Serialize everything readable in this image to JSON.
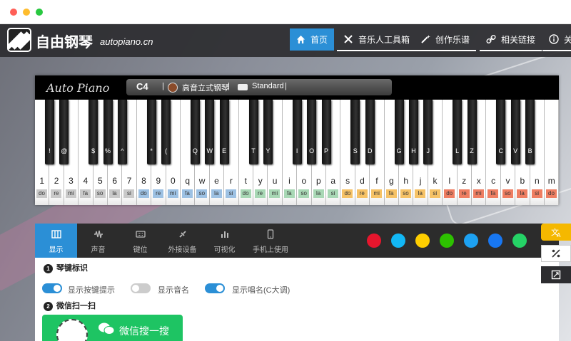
{
  "site": {
    "name": "自由钢琴",
    "domain": "autopiano.cn"
  },
  "nav": [
    {
      "label": "首页",
      "icon": "home-icon"
    },
    {
      "label": "音乐人工具箱",
      "icon": "tools-icon"
    },
    {
      "label": "创作乐谱",
      "icon": "magic-wand-icon"
    },
    {
      "label": "相关链接",
      "icon": "link-icon"
    },
    {
      "label": "关",
      "icon": "info-icon"
    }
  ],
  "piano_bar": {
    "script_logo": "Auto Piano",
    "note": "C4",
    "instrument": "高音立式钢琴",
    "mode": "Standard",
    "sep": "|"
  },
  "white_keys": [
    {
      "key": "1",
      "sol": "do",
      "color": "#c9c9c9"
    },
    {
      "key": "2",
      "sol": "re",
      "color": "#c9c9c9"
    },
    {
      "key": "3",
      "sol": "mi",
      "color": "#c9c9c9"
    },
    {
      "key": "4",
      "sol": "fa",
      "color": "#c9c9c9"
    },
    {
      "key": "5",
      "sol": "so",
      "color": "#c9c9c9"
    },
    {
      "key": "6",
      "sol": "la",
      "color": "#c9c9c9"
    },
    {
      "key": "7",
      "sol": "si",
      "color": "#c9c9c9"
    },
    {
      "key": "8",
      "sol": "do",
      "color": "#9dc1e3"
    },
    {
      "key": "9",
      "sol": "re",
      "color": "#9dc1e3"
    },
    {
      "key": "0",
      "sol": "mi",
      "color": "#9dc1e3"
    },
    {
      "key": "q",
      "sol": "fa",
      "color": "#9dc1e3"
    },
    {
      "key": "w",
      "sol": "so",
      "color": "#9dc1e3"
    },
    {
      "key": "e",
      "sol": "la",
      "color": "#9dc1e3"
    },
    {
      "key": "r",
      "sol": "si",
      "color": "#9dc1e3"
    },
    {
      "key": "t",
      "sol": "do",
      "color": "#a8d8b5"
    },
    {
      "key": "y",
      "sol": "re",
      "color": "#a8d8b5"
    },
    {
      "key": "u",
      "sol": "mi",
      "color": "#a8d8b5"
    },
    {
      "key": "i",
      "sol": "fa",
      "color": "#a8d8b5"
    },
    {
      "key": "o",
      "sol": "so",
      "color": "#a8d8b5"
    },
    {
      "key": "p",
      "sol": "la",
      "color": "#a8d8b5"
    },
    {
      "key": "a",
      "sol": "si",
      "color": "#a8d8b5"
    },
    {
      "key": "s",
      "sol": "do",
      "color": "#f6c266"
    },
    {
      "key": "d",
      "sol": "re",
      "color": "#f6c266"
    },
    {
      "key": "f",
      "sol": "mi",
      "color": "#f6c266"
    },
    {
      "key": "g",
      "sol": "fa",
      "color": "#f6c266"
    },
    {
      "key": "h",
      "sol": "so",
      "color": "#f6c266"
    },
    {
      "key": "j",
      "sol": "la",
      "color": "#f6c266"
    },
    {
      "key": "k",
      "sol": "si",
      "color": "#f6c266"
    },
    {
      "key": "l",
      "sol": "do",
      "color": "#ef7e62"
    },
    {
      "key": "z",
      "sol": "re",
      "color": "#ef7e62"
    },
    {
      "key": "x",
      "sol": "mi",
      "color": "#ef7e62"
    },
    {
      "key": "c",
      "sol": "fa",
      "color": "#ef7e62"
    },
    {
      "key": "v",
      "sol": "so",
      "color": "#ef7e62"
    },
    {
      "key": "b",
      "sol": "la",
      "color": "#ef7e62"
    },
    {
      "key": "n",
      "sol": "si",
      "color": "#ef7e62"
    },
    {
      "key": "m",
      "sol": "do",
      "color": "#ef7e62"
    }
  ],
  "black_keys": [
    {
      "after": 0,
      "key": "!"
    },
    {
      "after": 1,
      "key": "@"
    },
    {
      "after": 3,
      "key": "$"
    },
    {
      "after": 4,
      "key": "%"
    },
    {
      "after": 5,
      "key": "^"
    },
    {
      "after": 7,
      "key": "*"
    },
    {
      "after": 8,
      "key": "("
    },
    {
      "after": 10,
      "key": "Q"
    },
    {
      "after": 11,
      "key": "W"
    },
    {
      "after": 12,
      "key": "E"
    },
    {
      "after": 14,
      "key": "T"
    },
    {
      "after": 15,
      "key": "Y"
    },
    {
      "after": 17,
      "key": "I"
    },
    {
      "after": 18,
      "key": "O"
    },
    {
      "after": 19,
      "key": "P"
    },
    {
      "after": 21,
      "key": "S"
    },
    {
      "after": 22,
      "key": "D"
    },
    {
      "after": 24,
      "key": "G"
    },
    {
      "after": 25,
      "key": "H"
    },
    {
      "after": 26,
      "key": "J"
    },
    {
      "after": 28,
      "key": "L"
    },
    {
      "after": 29,
      "key": "Z"
    },
    {
      "after": 31,
      "key": "C"
    },
    {
      "after": 32,
      "key": "V"
    },
    {
      "after": 33,
      "key": "B"
    }
  ],
  "tabs": [
    {
      "label": "显示",
      "icon": "piano-icon",
      "active": true
    },
    {
      "label": "声音",
      "icon": "waveform-icon",
      "active": false
    },
    {
      "label": "键位",
      "icon": "keyboard-icon",
      "active": false
    },
    {
      "label": "外接设备",
      "icon": "plug-icon",
      "active": false
    },
    {
      "label": "可视化",
      "icon": "bar-chart-icon",
      "active": false
    },
    {
      "label": "手机上使用",
      "icon": "phone-icon",
      "active": false
    }
  ],
  "social": [
    {
      "name": "weibo-icon",
      "color": "#e6162d"
    },
    {
      "name": "qq-icon",
      "color": "#12b7f5"
    },
    {
      "name": "qzone-icon",
      "color": "#fece00"
    },
    {
      "name": "wechat-icon",
      "color": "#2dc100"
    },
    {
      "name": "twitter-icon",
      "color": "#1da1f2"
    },
    {
      "name": "facebook-icon",
      "color": "#1877f2"
    },
    {
      "name": "whatsapp-icon",
      "color": "#25d366"
    }
  ],
  "section1": {
    "num": "1",
    "title": "琴键标识"
  },
  "toggles": [
    {
      "label": "显示按键提示",
      "on": true
    },
    {
      "label": "显示音名",
      "on": false
    },
    {
      "label": "显示唱名(C大调)",
      "on": true
    }
  ],
  "section2": {
    "num": "2",
    "title": "微信扫一扫"
  },
  "wechat_search": "微信搜一搜",
  "colors": {
    "accent": "#2b8fd6",
    "header": "#2d2d30",
    "wechat": "#1ec463",
    "translate": "#f5b800"
  }
}
